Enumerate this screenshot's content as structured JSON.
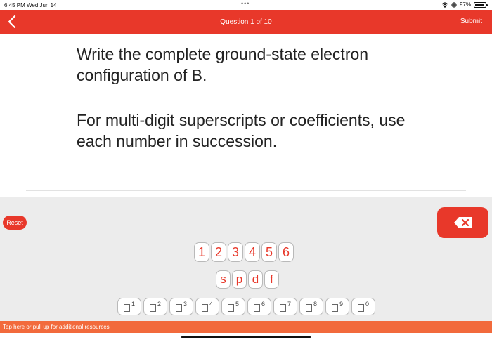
{
  "status_bar": {
    "time": "6:45 PM  Wed Jun 14",
    "dots": "•••",
    "battery": "97%",
    "icons": [
      "wifi-icon",
      "location-icon",
      "battery-icon"
    ]
  },
  "nav": {
    "title": "Question 1 of 10",
    "submit_label": "Submit",
    "back_icon": "chevron-left-icon"
  },
  "question": {
    "prompt": "Write the complete ground-state electron configuration of B.",
    "instruction": "For multi-digit superscripts or coefficients, use each number in succession."
  },
  "keyboard": {
    "reset_label": "Reset",
    "backspace_icon": "backspace-icon",
    "digits": [
      "1",
      "2",
      "3",
      "4",
      "5",
      "6"
    ],
    "orbitals": [
      "s",
      "p",
      "d",
      "f"
    ],
    "superscripts": [
      "1",
      "2",
      "3",
      "4",
      "5",
      "6",
      "7",
      "8",
      "9",
      "0"
    ]
  },
  "footer": {
    "resources_text": "Tap here or pull up for additional resources"
  },
  "colors": {
    "accent": "#e8382a",
    "resources_bar": "#f26a3c",
    "keyboard_bg": "#ececec"
  }
}
